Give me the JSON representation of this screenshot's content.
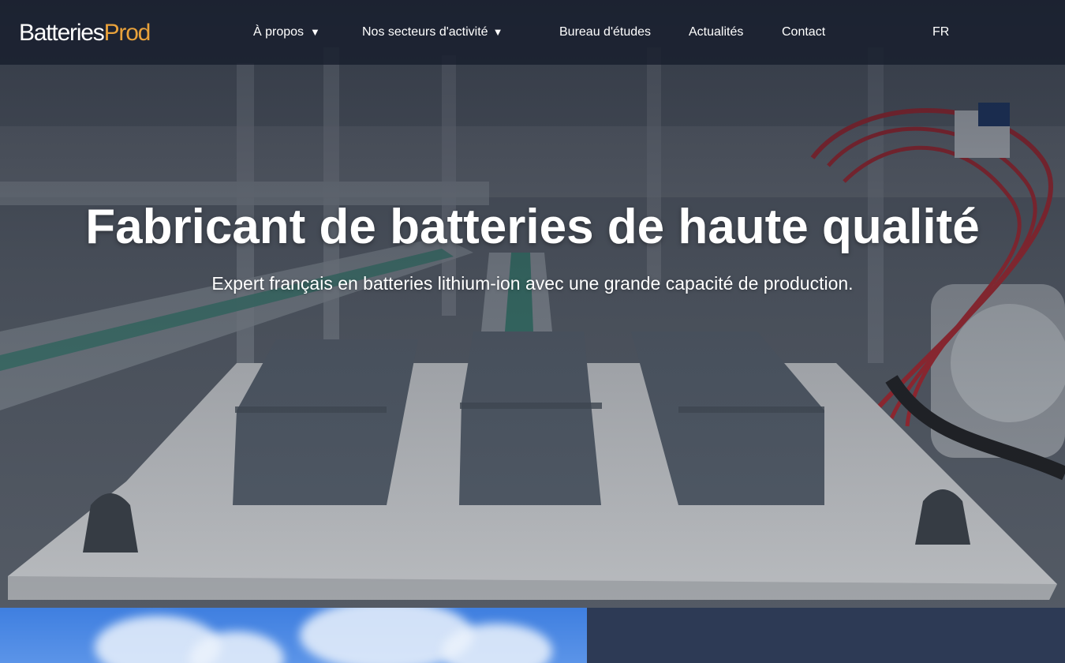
{
  "brand": {
    "name_part1": "Batteries",
    "name_part2": "Prod",
    "accent_color": "#e9a23b"
  },
  "nav": {
    "items": [
      {
        "label": "À propos",
        "has_dropdown": true,
        "icon": "caret-down-icon"
      },
      {
        "label": "Nos secteurs d'activité",
        "has_dropdown": true,
        "icon": "caret-down-icon"
      },
      {
        "label": "Bureau d'études",
        "has_dropdown": false
      },
      {
        "label": "Actualités",
        "has_dropdown": false
      },
      {
        "label": "Contact",
        "has_dropdown": false
      }
    ],
    "caret": "▼",
    "language": "FR"
  },
  "hero": {
    "title": "Fabricant de batteries de haute qualité",
    "subtitle": "Expert français en batteries lithium-ion avec une grande capacité de production."
  },
  "colors": {
    "nav_background": "#161c2c",
    "panel_left": "#3f7fe0",
    "panel_right": "#2d3a55"
  }
}
